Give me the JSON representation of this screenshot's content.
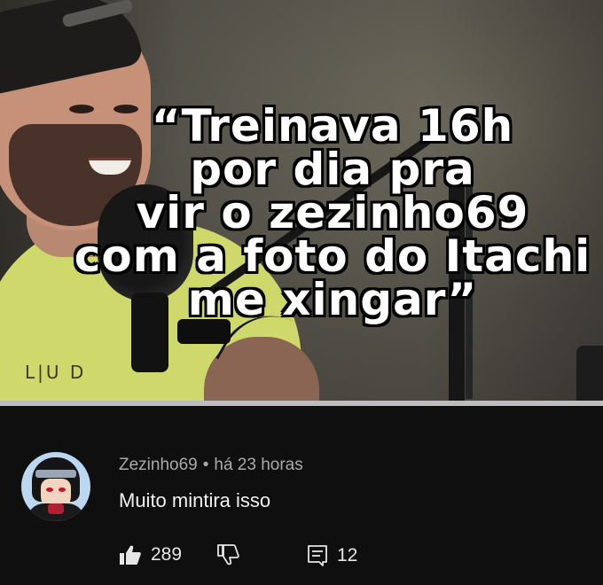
{
  "video": {
    "caption": "“Treinava 16h\npor dia pra\nvir o zezinho69\ncom a foto do Itachi\nme xingar”",
    "shirt_print": "L|U D",
    "progress_fraction": 1.0
  },
  "comment": {
    "author": "Zezinho69",
    "separator": "•",
    "time": "há 23 horas",
    "text": "Muito mintira isso",
    "likes": "289",
    "replies": "12",
    "icons": {
      "like": "thumbs-up-icon",
      "dislike": "thumbs-down-icon",
      "reply": "reply-icon"
    }
  },
  "colors": {
    "background": "#0f0f0f",
    "text_primary": "#f1f1f1",
    "text_secondary": "#aaaaaa"
  }
}
